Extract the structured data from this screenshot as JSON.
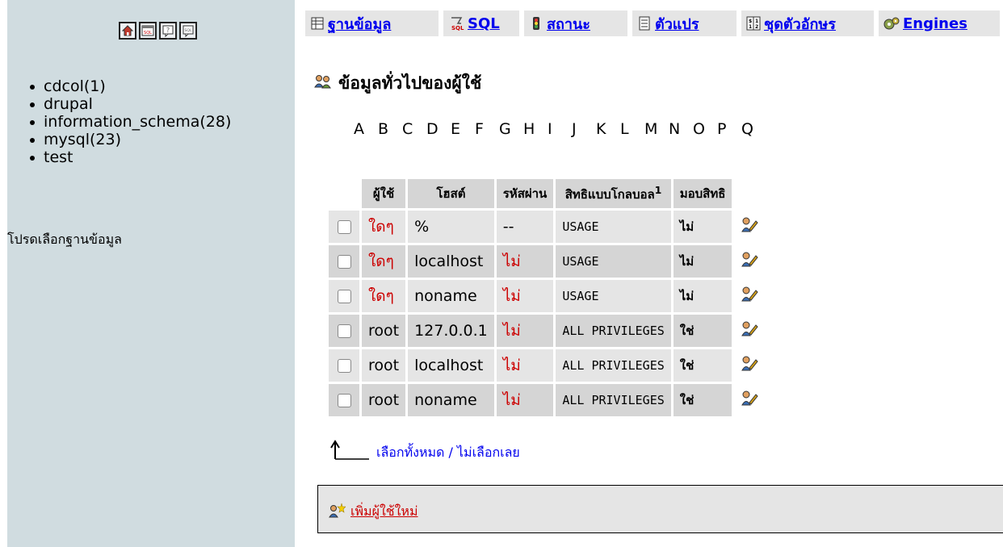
{
  "nav": {
    "icons": [
      "home-icon",
      "sql-query-icon",
      "help-icon",
      "sql-docs-icon"
    ],
    "databases": [
      {
        "name": "cdcol",
        "count": "(1)"
      },
      {
        "name": "drupal",
        "count": ""
      },
      {
        "name": "information_schema",
        "count": "(28)"
      },
      {
        "name": "mysql",
        "count": "(23)"
      },
      {
        "name": "test",
        "count": ""
      }
    ],
    "hint": "โปรดเลือกฐานข้อมูล"
  },
  "tabs": [
    {
      "label": "ฐานข้อมูล",
      "icon": "database-icon"
    },
    {
      "label": "SQL",
      "icon": "sql-icon"
    },
    {
      "label": "สถานะ",
      "icon": "status-icon"
    },
    {
      "label": "ตัวแปร",
      "icon": "variables-icon"
    },
    {
      "label": "ชุดตัวอักษร",
      "icon": "charset-icon"
    },
    {
      "label": "Engines",
      "icon": "engines-icon"
    }
  ],
  "page": {
    "title": "ข้อมูลทั่วไปของผู้ใช้",
    "letters": [
      "A",
      "B",
      "C",
      "D",
      "E",
      "F",
      "G",
      "H",
      "I",
      "J",
      "K",
      "L",
      "M",
      "N",
      "O",
      "P",
      "Q"
    ]
  },
  "table": {
    "headers": [
      "ผู้ใช้",
      "โฮสต์",
      "รหัสผ่าน",
      "สิทธิแบบโกลบอล",
      "มอบสิทธิ"
    ],
    "footnote_mark": "1",
    "rows": [
      {
        "user": "ใดๆ",
        "host": "%",
        "password": "--",
        "privileges": "USAGE",
        "grant": "ไม่"
      },
      {
        "user": "ใดๆ",
        "host": "localhost",
        "password": "ไม่",
        "privileges": "USAGE",
        "grant": "ไม่"
      },
      {
        "user": "ใดๆ",
        "host": "noname",
        "password": "ไม่",
        "privileges": "USAGE",
        "grant": "ไม่"
      },
      {
        "user": "root",
        "host": "127.0.0.1",
        "password": "ไม่",
        "privileges": "ALL PRIVILEGES",
        "grant": "ใช่"
      },
      {
        "user": "root",
        "host": "localhost",
        "password": "ไม่",
        "privileges": "ALL PRIVILEGES",
        "grant": "ใช่"
      },
      {
        "user": "root",
        "host": "noname",
        "password": "ไม่",
        "privileges": "ALL PRIVILEGES",
        "grant": "ใช่"
      }
    ]
  },
  "selection": {
    "check_all": "เลือกทั้งหมด",
    "separator": " / ",
    "uncheck_all": "ไม่เลือกเลย"
  },
  "add_user": {
    "label": "เพิ่มผู้ใช้ใหม่"
  },
  "colors": {
    "nav_bg": "#d0dce0",
    "tab_bg": "#e5e5e5",
    "row_odd": "#e5e5e5",
    "row_even": "#d5d5d5",
    "link": "#0000ee",
    "any_user_red": "#cc0000"
  }
}
